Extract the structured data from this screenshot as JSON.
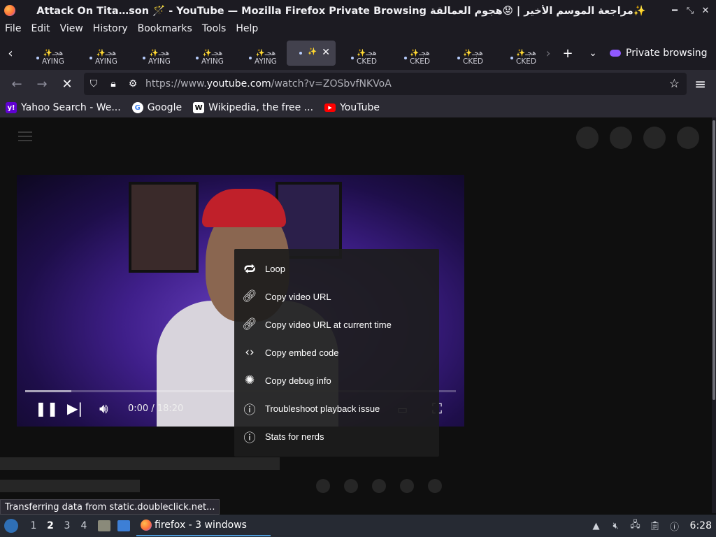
{
  "window": {
    "title": "Attack On Tita…son 🪄 - YouTube — Mozilla Firefox Private Browsing مراجعة الموسم الأخير | 😟هجوم العمالقة✨"
  },
  "menubar": {
    "items": [
      "File",
      "Edit",
      "View",
      "History",
      "Bookmarks",
      "Tools",
      "Help"
    ]
  },
  "tabs": [
    {
      "label": "✨هجـ\nAYING"
    },
    {
      "label": "✨هجـ\nAYING"
    },
    {
      "label": "✨هجـ\nAYING"
    },
    {
      "label": "✨هجـ\nAYING"
    },
    {
      "label": "✨هجـ\nAYING"
    },
    {
      "label": "✨",
      "active": true
    },
    {
      "label": "✨هجـ\nCKED"
    },
    {
      "label": "✨هجـ\nCKED"
    },
    {
      "label": "✨هجـ\nCKED"
    },
    {
      "label": "✨هجـ\nCKED"
    }
  ],
  "tabstrip": {
    "private_label": "Private browsing"
  },
  "navbar": {
    "url_prefix": "https://www.",
    "url_domain": "youtube.com",
    "url_path": "/watch?v=ZOSbvfNKVoA"
  },
  "bookmarks": [
    {
      "label": "Yahoo Search - We...",
      "color": "#6001d2",
      "glyph": "y!"
    },
    {
      "label": "Google",
      "color": "#ffffff",
      "glyph": "G"
    },
    {
      "label": "Wikipedia, the free ...",
      "color": "#ffffff",
      "glyph": "W"
    },
    {
      "label": "YouTube",
      "color": "#ff0000",
      "glyph": "▶"
    }
  ],
  "player": {
    "time": "0:00 / 18:20",
    "progress": 0.107
  },
  "context_menu": {
    "items": [
      {
        "icon": "loop-icon",
        "label": "Loop"
      },
      {
        "icon": "link-icon",
        "label": "Copy video URL"
      },
      {
        "icon": "link-icon",
        "label": "Copy video URL at current time"
      },
      {
        "icon": "code-icon",
        "label": "Copy embed code"
      },
      {
        "icon": "bug-icon",
        "label": "Copy debug info"
      },
      {
        "icon": "help-icon",
        "label": "Troubleshoot playback issue"
      },
      {
        "icon": "info-icon",
        "label": "Stats for nerds"
      }
    ]
  },
  "status": {
    "text": "Transferring data from static.doubleclick.net..."
  },
  "taskbar": {
    "workspaces": [
      "1",
      "2",
      "3",
      "4"
    ],
    "current_workspace": "2",
    "task_label": "firefox - 3 windows",
    "clock": "6:28"
  }
}
